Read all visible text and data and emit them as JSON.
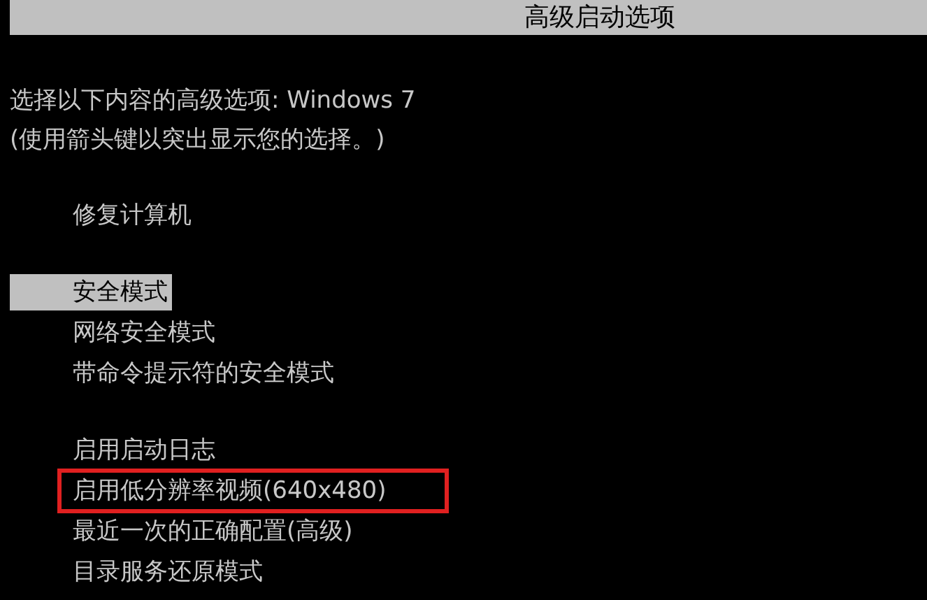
{
  "title_bar": {
    "title": "高级启动选项"
  },
  "intro": [
    "选择以下内容的高级选项: Windows 7",
    "(使用箭头键以突出显示您的选择。)"
  ],
  "menu_groups": [
    {
      "items": [
        {
          "label": "修复计算机",
          "selected": false,
          "annotated": false
        }
      ]
    },
    {
      "items": [
        {
          "label": "安全模式",
          "selected": true,
          "annotated": false
        },
        {
          "label": "网络安全模式",
          "selected": false,
          "annotated": false
        },
        {
          "label": "带命令提示符的安全模式",
          "selected": false,
          "annotated": false
        }
      ]
    },
    {
      "items": [
        {
          "label": "启用启动日志",
          "selected": false,
          "annotated": false
        },
        {
          "label": "启用低分辨率视频(640x480)",
          "selected": false,
          "annotated": true
        },
        {
          "label": "最近一次的正确配置(高级)",
          "selected": false,
          "annotated": false
        },
        {
          "label": "目录服务还原模式",
          "selected": false,
          "annotated": false
        }
      ]
    }
  ]
}
